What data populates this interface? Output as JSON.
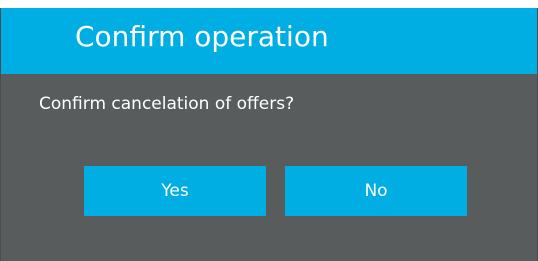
{
  "dialog": {
    "title": "Confirm operation",
    "message": "Confirm cancelation of offers?",
    "buttons": {
      "yes_label": "Yes",
      "no_label": "No"
    }
  },
  "colors": {
    "accent": "#00aee4",
    "body_background": "#585c5c",
    "text": "#ffffff"
  }
}
